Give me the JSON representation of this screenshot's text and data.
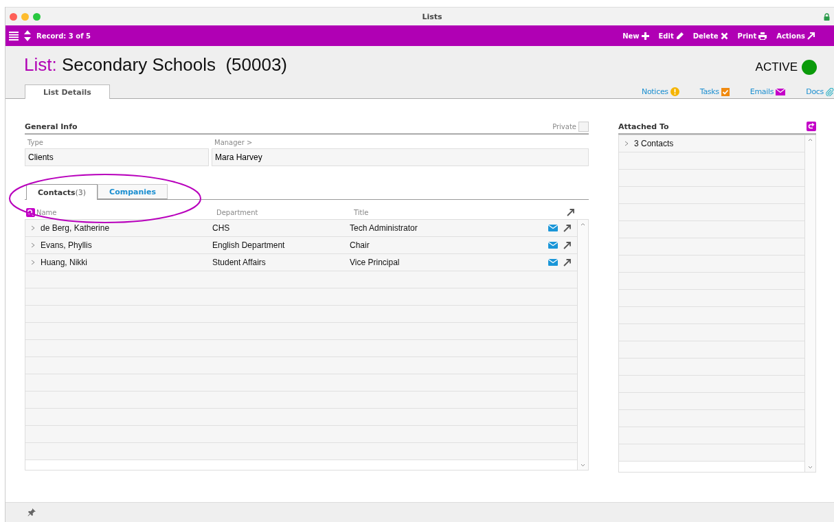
{
  "window": {
    "title": "Lists"
  },
  "toolbar": {
    "record": "Record: 3 of 5",
    "actions": [
      {
        "label": "New",
        "kind": "plus"
      },
      {
        "label": "Edit",
        "kind": "pencil"
      },
      {
        "label": "Delete",
        "kind": "cross"
      },
      {
        "label": "Print",
        "kind": "printer"
      },
      {
        "label": "Actions",
        "kind": "arrow"
      }
    ]
  },
  "header": {
    "prefix": "List:",
    "title": "Secondary Schools",
    "number": "(50003)",
    "status": "ACTIVE",
    "active": true
  },
  "tabs": [
    {
      "label": "List Details",
      "selected": true
    }
  ],
  "links": [
    {
      "label": "Notices",
      "kind": "notice"
    },
    {
      "label": "Tasks",
      "kind": "task"
    },
    {
      "label": "Emails",
      "kind": "email"
    },
    {
      "label": "Docs",
      "kind": "clip"
    }
  ],
  "general_info": {
    "title": "General Info",
    "private": {
      "label": "Private",
      "checked": false
    },
    "fields": [
      {
        "label": "Type",
        "value": "Clients"
      },
      {
        "label": "Manager >",
        "value": "Mara Harvey"
      }
    ]
  },
  "subtabs": [
    {
      "label": "Contacts",
      "count": "(3)",
      "selected": true
    },
    {
      "label": "Companies",
      "selected": false
    }
  ],
  "table": {
    "columns": [
      "Name",
      "Department",
      "Title"
    ],
    "rows": [
      {
        "name": "de Berg, Katherine",
        "department": "CHS",
        "title": "Tech Administrator"
      },
      {
        "name": "Evans, Phyllis",
        "department": "English Department",
        "title": "Chair"
      },
      {
        "name": "Huang, Nikki",
        "department": "Student Affairs",
        "title": "Vice Principal"
      }
    ]
  },
  "attached_to": {
    "title": "Attached To",
    "items": [
      "3 Contacts"
    ]
  }
}
